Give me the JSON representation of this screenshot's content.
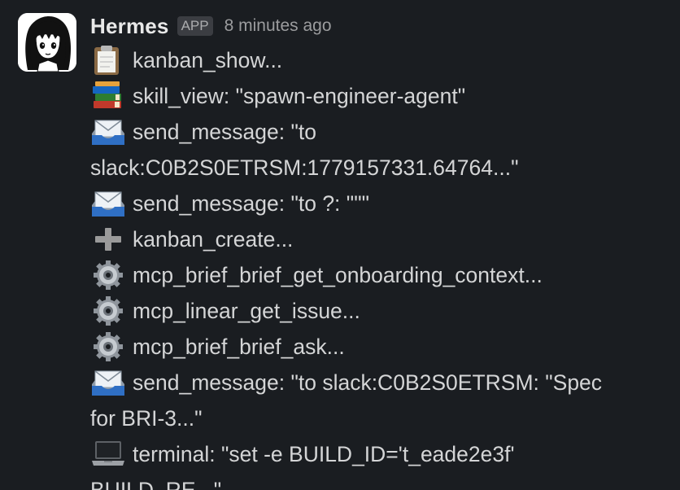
{
  "message": {
    "sender": "Hermes",
    "badge": "APP",
    "timestamp": "8 minutes ago",
    "avatar_icon": "anime-girl-avatar"
  },
  "lines": [
    {
      "icon": "clipboard-icon",
      "text": "kanban_show..."
    },
    {
      "icon": "books-icon",
      "text": "skill_view: \"spawn-engineer-agent\""
    },
    {
      "icon": "envelope-tray-icon",
      "text": "send_message: \"to"
    },
    {
      "icon": "",
      "text": "slack:C0B2S0ETRSM:1779157331.64764...\""
    },
    {
      "icon": "envelope-tray-icon",
      "text": "send_message: \"to ?: \"\"\""
    },
    {
      "icon": "plus-icon",
      "text": "kanban_create..."
    },
    {
      "icon": "gear-icon",
      "text": "mcp_brief_brief_get_onboarding_context..."
    },
    {
      "icon": "gear-icon",
      "text": "mcp_linear_get_issue..."
    },
    {
      "icon": "gear-icon",
      "text": "mcp_brief_brief_ask..."
    },
    {
      "icon": "envelope-tray-icon",
      "text": "send_message: \"to slack:C0B2S0ETRSM: \"Spec"
    },
    {
      "icon": "",
      "text": "for BRI-3...\""
    },
    {
      "icon": "laptop-icon",
      "text": "terminal: \"set -e BUILD_ID='t_eade2e3f'"
    },
    {
      "icon": "",
      "text": "BUILD_RE...\""
    }
  ]
}
